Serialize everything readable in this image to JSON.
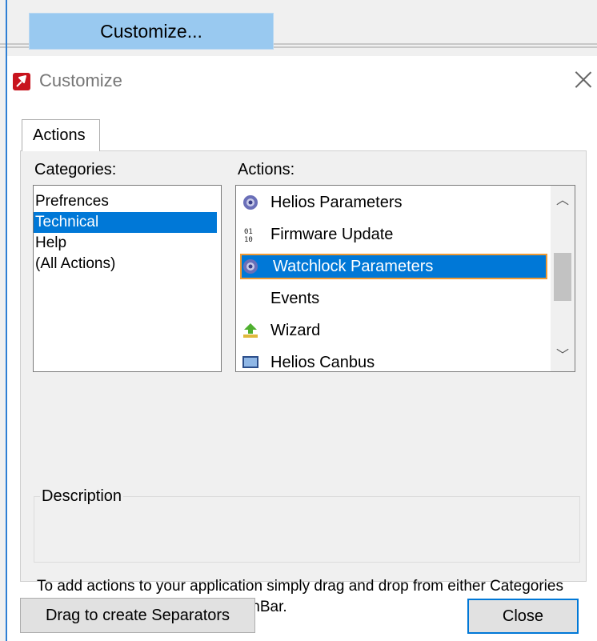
{
  "toolbar": {
    "customize_button": "Customize..."
  },
  "dialog": {
    "title": "Customize",
    "close_symbol": "×",
    "tab_label": "Actions",
    "categories_label": "Categories:",
    "actions_label": "Actions:",
    "categories": [
      "Prefrences",
      "Technical",
      "Help",
      "(All Actions)"
    ],
    "selected_category": "Technical",
    "actions": [
      {
        "label": "Helios Parameters",
        "icon": "gear-icon"
      },
      {
        "label": "Firmware Update",
        "icon": "binary-icon"
      },
      {
        "label": "Watchlock Parameters",
        "icon": "gear-icon"
      },
      {
        "label": "Events",
        "icon": ""
      },
      {
        "label": "Wizard",
        "icon": "wizard-arrow-icon"
      },
      {
        "label": "Helios Canbus",
        "icon": "monitor-icon"
      }
    ],
    "selected_action": "Watchlock Parameters",
    "description_label": "Description",
    "description_text": "",
    "help_text": "To add actions to your application simply drag and drop from either Categories or Actions onto an existing ActionBar.",
    "separators_button": "Drag to create Separators",
    "close_button": "Close"
  },
  "colors": {
    "accent": "#0078d7",
    "menu_highlight": "#99c9f0",
    "focus": "#f09a33",
    "app_icon": "#c8141e"
  }
}
